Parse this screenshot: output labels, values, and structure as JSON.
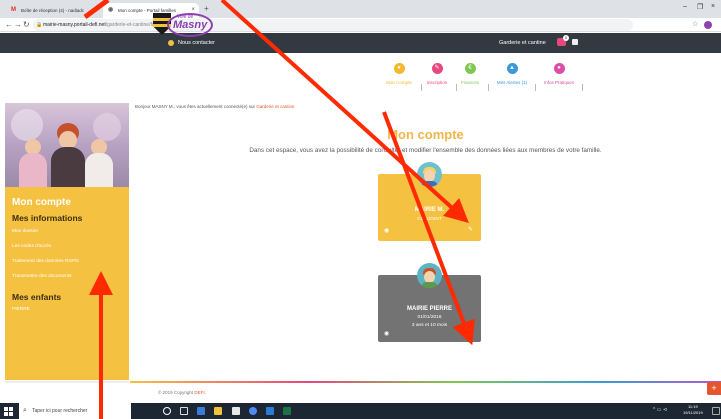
{
  "browser": {
    "tabs": [
      {
        "label": "Boîte de réception (4) - nadiadc",
        "icon": "gmail-icon",
        "active": false
      },
      {
        "label": "Mon compte - Portail familles",
        "icon": "page-icon",
        "active": true
      }
    ],
    "url_host": "mairie-masny.portail-defi.net",
    "url_path": "/garderie-et-cantine/famille/"
  },
  "site_top": {
    "contact_label": "Nous contacter",
    "service_label": "Garderie et cantine",
    "cart_count": "0"
  },
  "logo": {
    "small": "Ville de",
    "big": "Masny"
  },
  "menu": [
    {
      "label": "Mon Compte",
      "color": "#f5b82e",
      "glyph": "●"
    },
    {
      "label": "Inscription",
      "color": "#e8477e",
      "glyph": "✎"
    },
    {
      "label": "Finances",
      "color": "#7ec850",
      "glyph": "€"
    },
    {
      "label": "Mes Alertes (1)",
      "color": "#3a9ad9",
      "glyph": "▲"
    },
    {
      "label": "Infos Pratiques",
      "color": "#d94fa8",
      "glyph": "●"
    }
  ],
  "sidebar": {
    "title": "Mon compte",
    "info_heading": "Mes informations",
    "info_links": [
      "Mon dossier",
      "Les codes d'accès",
      "Traitement des données RGPD",
      "Transmettre des documents"
    ],
    "children_heading": "Mes enfants",
    "children_links": [
      "PIERRE"
    ]
  },
  "main": {
    "breadcrumb_prefix": "Bonjour MASNY M., vous êtes actuellement connecté(e) sur",
    "breadcrumb_site": "Garderie et cantine",
    "title": "Mon compte",
    "description": "Dans cet espace, vous avez la possibilité de consulter et modifier l'ensemble des données liées aux membres de votre famille.",
    "cards": [
      {
        "name": "MAIRIE M.",
        "sub1": "CONJOINT",
        "sub2": ""
      },
      {
        "name": "MAIRIE PIERRE",
        "sub1": "01/01/2016",
        "sub2": "3 ans et 10 mois"
      }
    ]
  },
  "footer": {
    "copyright": "© 2019 Copyright",
    "brand": "DEFI."
  },
  "taskbar": {
    "search_placeholder": "Taper ici pour rechercher",
    "time": "11:19",
    "date": "19/11/2019"
  },
  "colors": {
    "accent_yellow": "#f5c140",
    "title_orange": "#f0b64a",
    "arrow_red": "#ff2a00"
  }
}
